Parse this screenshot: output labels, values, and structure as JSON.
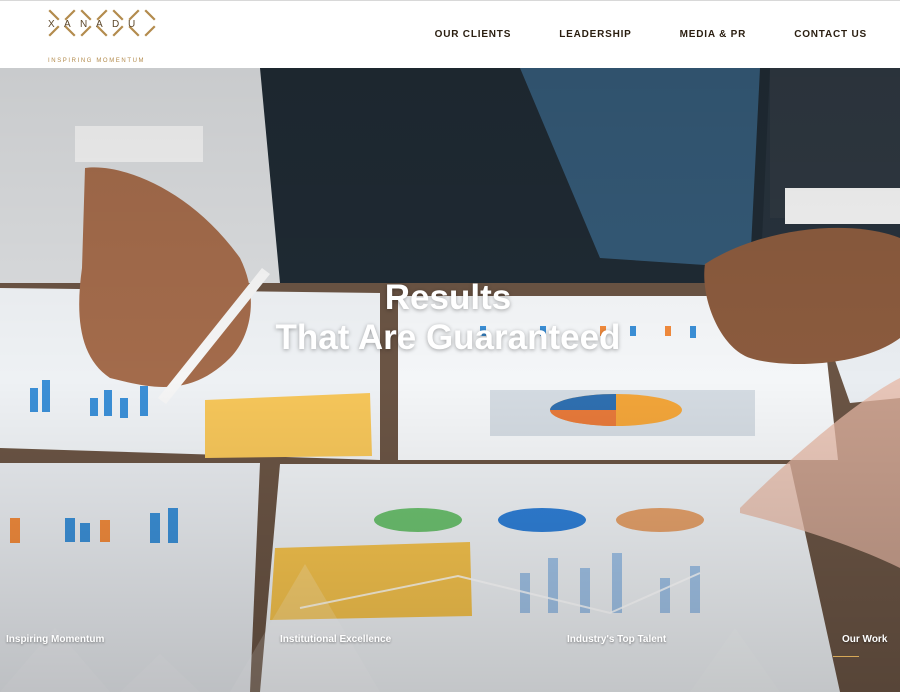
{
  "brand": {
    "name": "XANADU",
    "tagline": "INSPIRING MOMENTUM",
    "accent_color": "#b38b4d"
  },
  "nav": {
    "items": [
      {
        "label": "OUR CLIENTS"
      },
      {
        "label": "LEADERSHIP"
      },
      {
        "label": "MEDIA & PR"
      },
      {
        "label": "CONTACT US"
      }
    ]
  },
  "hero": {
    "headline_line1": "Results",
    "headline_line2": "That Are Guaranteed",
    "slides": [
      {
        "label": "Inspiring Momentum",
        "active": false
      },
      {
        "label": "Institutional Excellence",
        "active": false
      },
      {
        "label": "Industry's Top Talent",
        "active": false
      },
      {
        "label": "Our Work",
        "active": true
      }
    ],
    "active_indicator_color": "#d7a857"
  }
}
